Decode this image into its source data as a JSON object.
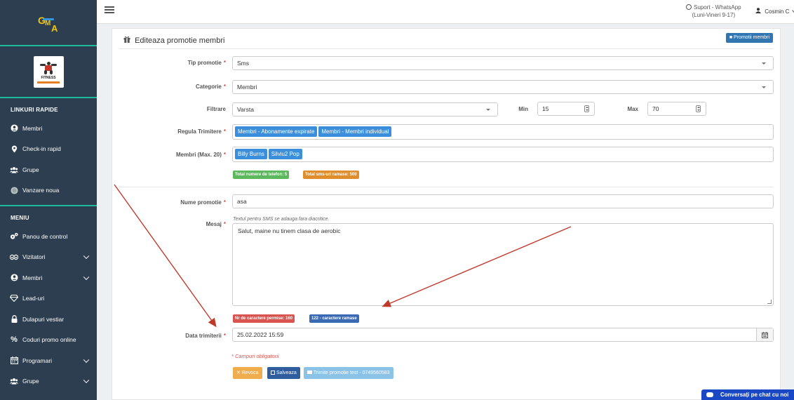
{
  "sidebar": {
    "brand": {
      "letters": "GMA"
    },
    "gym_logo_text": "FITNESS",
    "quick_links_title": "LINKURI RAPIDE",
    "quick_links": [
      {
        "label": "Membri",
        "icon": "user-circle-icon"
      },
      {
        "label": "Check-in rapid",
        "icon": "map-pin-icon"
      },
      {
        "label": "Grupe",
        "icon": "users-icon"
      },
      {
        "label": "Vanzare noua",
        "icon": "coin-icon"
      }
    ],
    "menu_title": "MENIU",
    "menu": [
      {
        "label": "Panou de control",
        "icon": "gears-icon",
        "chevron": false
      },
      {
        "label": "Vizitatori",
        "icon": "eye-icon",
        "chevron": true
      },
      {
        "label": "Membri",
        "icon": "user-circle-icon",
        "chevron": true
      },
      {
        "label": "Lead-uri",
        "icon": "diamond-icon",
        "chevron": false
      },
      {
        "label": "Dulapuri vestiar",
        "icon": "lock-icon",
        "chevron": false
      },
      {
        "label": "Coduri promo online",
        "icon": "percent-icon",
        "chevron": false
      },
      {
        "label": "Programari",
        "icon": "calendar-icon",
        "chevron": true
      },
      {
        "label": "Grupe",
        "icon": "users-icon",
        "chevron": true
      }
    ]
  },
  "topbar": {
    "support_line1": "Suport - WhatsApp",
    "support_line2": "(Luni-Vineri 9-17)",
    "user_name": "Cosmin C"
  },
  "panel": {
    "title": "Editeaza promotie membri",
    "back_button": "Promotii membri",
    "fields": {
      "tip_promotie": {
        "label": "Tip promotie",
        "value": "Sms"
      },
      "categorie": {
        "label": "Categorie",
        "value": "Membri"
      },
      "filtrare": {
        "label": "Filtrare",
        "value": "Varsta",
        "min_label": "Min",
        "min_value": "15",
        "max_label": "Max",
        "max_value": "70"
      },
      "regula": {
        "label": "Regula Trimitere",
        "tags": [
          "Membri - Abonamente expirate",
          "Membri - Membri individual"
        ]
      },
      "membri": {
        "label": "Membri (Max. 20)",
        "tags": [
          "Billy Burns",
          "Silviu2 Pop"
        ]
      },
      "nume_promotie": {
        "label": "Nume promotie",
        "value": "asa"
      },
      "mesaj": {
        "label": "Mesaj",
        "hint": "Textul pentru SMS se adauga fara diacritice.",
        "value": "Salut, maine nu tinem clasa de aerobic"
      },
      "data": {
        "label": "Data trimiterii",
        "value": "25.02.2022 15:59"
      }
    },
    "badges": {
      "phones": "Total numere de telefon: 5",
      "sms_left": "Total sms-uri ramase: 500",
      "chars_allowed": "Nr de caractere permise: 160",
      "chars_left": "122 - caractere ramase"
    },
    "required_note": "* Campuri obligatorii",
    "buttons": {
      "revoca": "Revoca",
      "salveaza": "Salveaza",
      "test": "Trimite promotie test - 0749560583"
    }
  },
  "chat_widget": "Conversați pe chat cu noi",
  "colors": {
    "sidebar_bg": "#2c3e50",
    "accent_teal": "#1abc9c",
    "primary_blue": "#3a8edc",
    "badge_green": "#5cb85c",
    "badge_orange": "#e08e2b",
    "badge_red": "#d9534f",
    "arrow_red": "#c0392b",
    "chat_blue": "#1a48c4"
  }
}
